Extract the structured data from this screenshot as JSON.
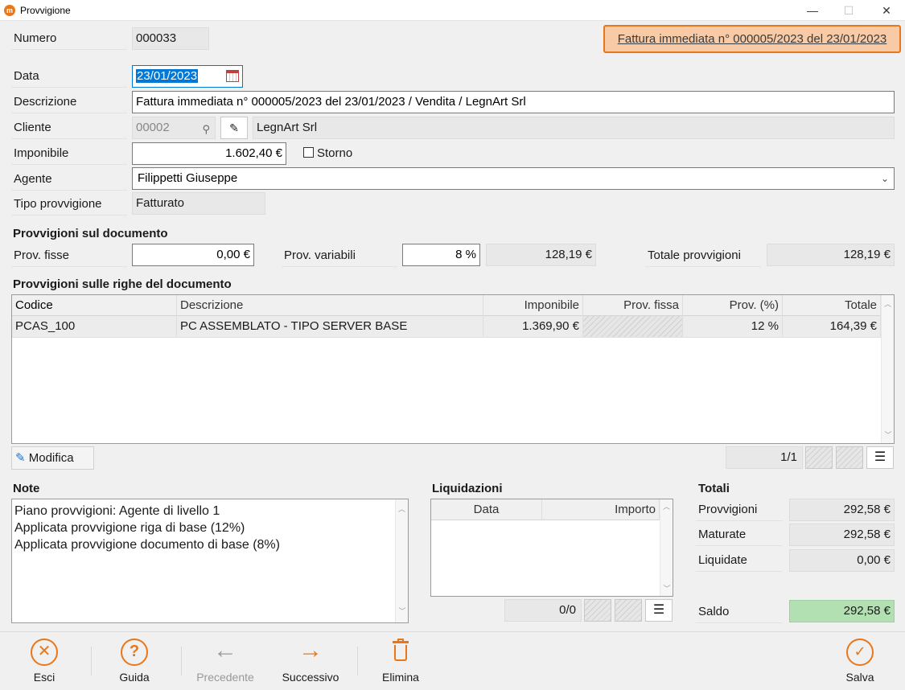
{
  "window": {
    "title": "Provvigione",
    "min": "—",
    "max": "☐",
    "close": "✕"
  },
  "invoice_link": "Fattura immediata n° 000005/2023 del 23/01/2023",
  "form": {
    "numero_label": "Numero",
    "numero_value": "000033",
    "data_label": "Data",
    "data_value": "23/01/2023",
    "descrizione_label": "Descrizione",
    "descrizione_value": "Fattura immediata n° 000005/2023 del 23/01/2023 / Vendita / LegnArt Srl",
    "cliente_label": "Cliente",
    "cliente_code": "00002",
    "cliente_name": "LegnArt Srl",
    "imponibile_label": "Imponibile",
    "imponibile_value": "1.602,40 €",
    "storno_label": "Storno",
    "agente_label": "Agente",
    "agente_value": "Filippetti Giuseppe",
    "tipo_label": "Tipo provvigione",
    "tipo_value": "Fatturato"
  },
  "doc_section": {
    "title": "Provvigioni sul documento",
    "fisse_label": "Prov. fisse",
    "fisse_value": "0,00 €",
    "variabili_label": "Prov. variabili",
    "variabili_pct": "8 %",
    "variabili_value": "128,19 €",
    "totale_label": "Totale provvigioni",
    "totale_value": "128,19 €"
  },
  "rows_section": {
    "title": "Provvigioni sulle righe del documento",
    "columns": [
      "Codice",
      "Descrizione",
      "Imponibile",
      "Prov. fissa",
      "Prov. (%)",
      "Totale"
    ],
    "rows": [
      {
        "codice": "PCAS_100",
        "descrizione": "PC ASSEMBLATO - TIPO SERVER BASE",
        "imponibile": "1.369,90 €",
        "fissa": "",
        "perc": "12 %",
        "totale": "164,39 €"
      }
    ],
    "modifica_label": "Modifica",
    "pager": "1/1"
  },
  "note": {
    "title": "Note",
    "lines": [
      "Piano provvigioni: Agente di livello 1",
      "Applicata provvigione riga di base (12%)",
      "Applicata provvigione documento di base (8%)"
    ]
  },
  "liquidazioni": {
    "title": "Liquidazioni",
    "columns": [
      "Data",
      "Importo"
    ],
    "pager": "0/0"
  },
  "totali": {
    "title": "Totali",
    "provvigioni_label": "Provvigioni",
    "provvigioni_value": "292,58 €",
    "maturate_label": "Maturate",
    "maturate_value": "292,58 €",
    "liquidate_label": "Liquidate",
    "liquidate_value": "0,00 €",
    "saldo_label": "Saldo",
    "saldo_value": "292,58 €"
  },
  "toolbar": {
    "esci": "Esci",
    "guida": "Guida",
    "precedente": "Precedente",
    "successivo": "Successivo",
    "elimina": "Elimina",
    "salva": "Salva"
  },
  "colors": {
    "accent": "#e8771a",
    "saldo_bg": "#b3e0b3",
    "link_bg": "#f8cba6"
  }
}
